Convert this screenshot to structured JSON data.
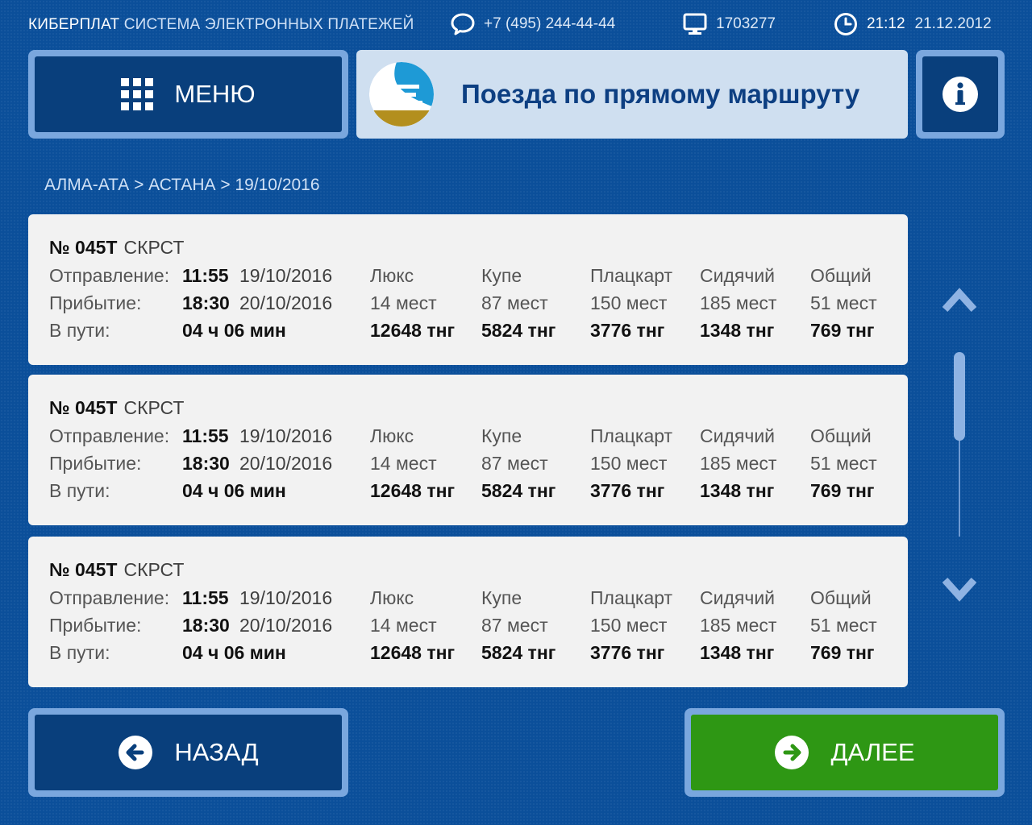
{
  "status": {
    "brand_main": "КИБЕРПЛАТ",
    "brand_sub": "СИСТЕМА ЭЛЕКТРОННЫХ ПЛАТЕЖЕЙ",
    "phone": "+7 (495) 244-44-44",
    "terminal_id": "1703277",
    "time": "21:12",
    "date": "21.12.2012"
  },
  "header": {
    "menu_label": "МЕНЮ",
    "title": "Поезда по прямому маршруту"
  },
  "breadcrumb": "АЛМА-АТА > АСТАНА > 19/10/2016",
  "labels": {
    "departure": "Отправление:",
    "arrival": "Прибытие:",
    "duration": "В пути:"
  },
  "trains": [
    {
      "number": "№ 045Т",
      "type": "СКРСТ",
      "dep_time": "11:55",
      "dep_date": "19/10/2016",
      "arr_time": "18:30",
      "arr_date": "20/10/2016",
      "duration": "04 ч 06 мин",
      "classes": [
        {
          "name": "Люкс",
          "seats": "14 мест",
          "price": "12648 тнг"
        },
        {
          "name": "Купе",
          "seats": "87 мест",
          "price": "5824 тнг"
        },
        {
          "name": "Плацкарт",
          "seats": "150 мест",
          "price": "3776 тнг"
        },
        {
          "name": "Сидячий",
          "seats": "185 мест",
          "price": "1348 тнг"
        },
        {
          "name": "Общий",
          "seats": "51 мест",
          "price": "769 тнг"
        }
      ]
    },
    {
      "number": "№ 045Т",
      "type": "СКРСТ",
      "dep_time": "11:55",
      "dep_date": "19/10/2016",
      "arr_time": "18:30",
      "arr_date": "20/10/2016",
      "duration": "04 ч 06 мин",
      "classes": [
        {
          "name": "Люкс",
          "seats": "14 мест",
          "price": "12648 тнг"
        },
        {
          "name": "Купе",
          "seats": "87 мест",
          "price": "5824 тнг"
        },
        {
          "name": "Плацкарт",
          "seats": "150 мест",
          "price": "3776 тнг"
        },
        {
          "name": "Сидячий",
          "seats": "185 мест",
          "price": "1348 тнг"
        },
        {
          "name": "Общий",
          "seats": "51 мест",
          "price": "769 тнг"
        }
      ]
    },
    {
      "number": "№ 045Т",
      "type": "СКРСТ",
      "dep_time": "11:55",
      "dep_date": "19/10/2016",
      "arr_time": "18:30",
      "arr_date": "20/10/2016",
      "duration": "04 ч 06 мин",
      "classes": [
        {
          "name": "Люкс",
          "seats": "14 мест",
          "price": "12648 тнг"
        },
        {
          "name": "Купе",
          "seats": "87 мест",
          "price": "5824 тнг"
        },
        {
          "name": "Плацкарт",
          "seats": "150 мест",
          "price": "3776 тнг"
        },
        {
          "name": "Сидячий",
          "seats": "185 мест",
          "price": "1348 тнг"
        },
        {
          "name": "Общий",
          "seats": "51 мест",
          "price": "769 тнг"
        }
      ]
    }
  ],
  "footer": {
    "back_label": "НАЗАД",
    "next_label": "ДАЛЕЕ"
  },
  "icons": {
    "phone": "chat-bubble-icon",
    "terminal": "monitor-icon",
    "clock": "clock-icon",
    "menu": "grid-icon",
    "info": "info-icon",
    "back": "arrow-left-circle-icon",
    "next": "arrow-right-circle-icon"
  },
  "colors": {
    "background": "#0b4f9a",
    "button_dark": "#093f7c",
    "button_frame": "#7aa7de",
    "next_green": "#2e9714",
    "title_box": "#cfdff0",
    "title_text": "#0d3f82",
    "card": "#f2f2f2"
  }
}
